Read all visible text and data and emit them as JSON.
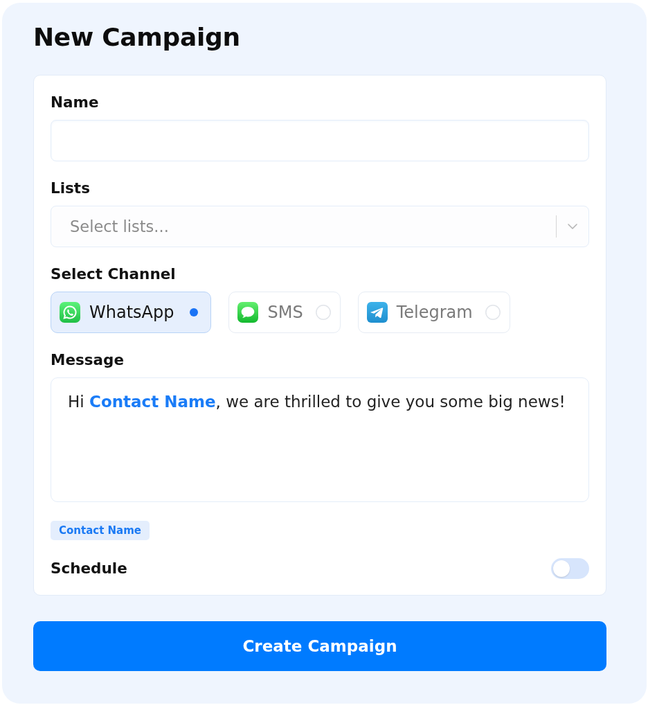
{
  "title": "New Campaign",
  "name_field": {
    "label": "Name"
  },
  "lists_field": {
    "label": "Lists",
    "placeholder": "Select lists..."
  },
  "channel": {
    "label": "Select Channel",
    "options": [
      {
        "label": "WhatsApp",
        "kind": "phonechat",
        "selected": true
      },
      {
        "label": "SMS",
        "kind": "bubble",
        "selected": false
      },
      {
        "label": "Telegram",
        "kind": "plane",
        "selected": false
      }
    ]
  },
  "message": {
    "label": "Message",
    "value": "Hi **Contact Name**, we are thrilled to give you some big news!"
  },
  "variables": [
    "Contact Name"
  ],
  "schedule": {
    "label": "Schedule",
    "on": false
  },
  "submit": {
    "label": "Create Campaign"
  }
}
